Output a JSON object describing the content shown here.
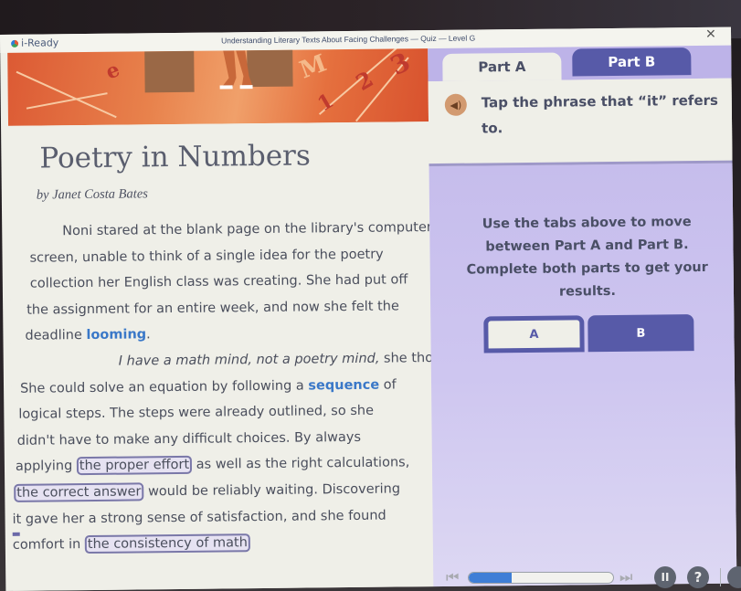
{
  "app": {
    "brand": "i-Ready",
    "quiz_title": "Understanding Literary Texts About Facing Challenges — Quiz — Level G",
    "close_icon": "close-icon"
  },
  "banner": {
    "numbers": [
      "1",
      "2",
      "3"
    ],
    "letters": [
      "e",
      "M"
    ]
  },
  "passage": {
    "title": "Poetry in Numbers",
    "author": "by Janet Costa Bates",
    "lines": [
      {
        "text": "Noni stared at the blank page on the library's computer"
      },
      {
        "text": "screen, unable to think of a single idea for the poetry"
      },
      {
        "text": "collection her English class was creating. She had put off"
      },
      {
        "text": "the assignment for an entire week, and now she felt the"
      },
      {
        "pre": "deadline ",
        "vocab": "looming",
        "post": "."
      },
      {
        "italic": "I have a math mind, not a poetry mind,",
        "post": " she thought."
      },
      {
        "pre": "She could solve an equation by following a ",
        "vocab": "sequence",
        "post": " of"
      },
      {
        "text": "logical steps. The steps were already outlined, so she"
      },
      {
        "text": "didn't have to make any difficult choices.  By always"
      },
      {
        "pre": "applying ",
        "choice": "the proper effort",
        "post": " as well as the right calculations,"
      },
      {
        "choice": "the correct answer",
        "post": " would be reliably waiting. Discovering"
      },
      {
        "marker": "it",
        "post": " gave her a strong sense of satisfaction, and she found"
      },
      {
        "pre": "comfort in ",
        "choice": "the consistency of math"
      }
    ]
  },
  "question": {
    "tabs": [
      {
        "label": "Part A",
        "active": true
      },
      {
        "label": "Part B",
        "active": false
      }
    ],
    "audio_icon": "speaker-icon",
    "prompt": "Tap the phrase that “it” refers to.",
    "instructions": "Use the tabs above to move between Part A and Part B. Complete both parts to get your results.",
    "part_buttons": [
      {
        "label": "A",
        "selected": true
      },
      {
        "label": "B",
        "selected": false
      }
    ]
  },
  "footer": {
    "progress_percent": 30,
    "prev_icon": "skip-back-icon",
    "next_icon": "skip-forward-icon",
    "pause_icon": "pause-icon",
    "help_icon": "help-icon",
    "help_glyph": "?",
    "pause_glyph": "II"
  },
  "colors": {
    "accent_purple": "#575aa8",
    "panel_purple": "#c6bdec",
    "vocab_blue": "#3a78c8",
    "progress_blue": "#3f7ed6",
    "banner_orange": "#dc5a34"
  }
}
